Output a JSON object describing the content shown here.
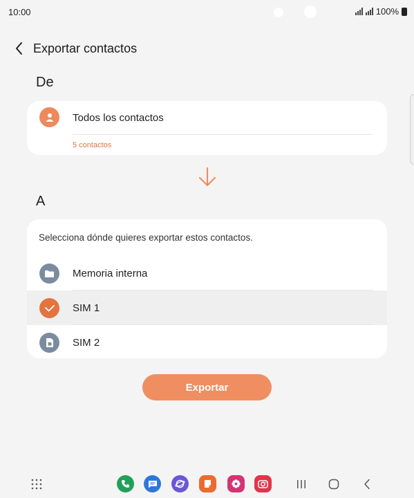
{
  "status": {
    "time": "10:00",
    "battery": "100%"
  },
  "header": {
    "title": "Exportar contactos"
  },
  "from": {
    "label": "De",
    "source_name": "Todos los contactos",
    "source_count": "5 contactos"
  },
  "to": {
    "label": "A",
    "instruction": "Selecciona dónde quieres exportar estos contactos.",
    "options": [
      {
        "label": "Memoria interna",
        "icon": "folder-icon",
        "selected": false
      },
      {
        "label": "SIM 1",
        "icon": "checkmark-icon",
        "selected": true
      },
      {
        "label": "SIM 2",
        "icon": "sim-card-icon",
        "selected": false
      }
    ]
  },
  "actions": {
    "export_label": "Exportar"
  },
  "colors": {
    "accent": "#ef8e60",
    "selected_row": "#efefef",
    "neutral_icon": "#7c8ca0"
  },
  "dock": {
    "apps": [
      "phone-icon",
      "messages-icon",
      "internet-icon",
      "notes-icon",
      "gallery-icon",
      "camera-icon"
    ],
    "nav": [
      "app-drawer-icon",
      "recents-icon",
      "home-icon",
      "back-icon"
    ]
  }
}
